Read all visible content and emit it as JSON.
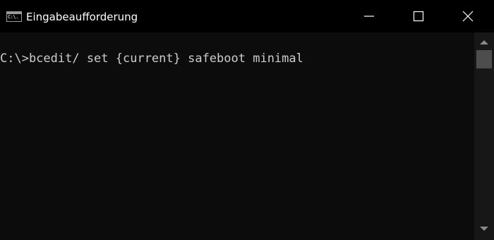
{
  "window": {
    "title": "Eingabeaufforderung",
    "icon": "cmd-icon",
    "icon_text": "C:\\."
  },
  "console": {
    "lines": [
      "C:\\>bcedit/ set {current} safeboot minimal"
    ]
  },
  "colors": {
    "titlebar_bg": "#000000",
    "console_bg": "#0c0c0c",
    "console_text": "#cccccc",
    "title_text": "#ffffff"
  }
}
